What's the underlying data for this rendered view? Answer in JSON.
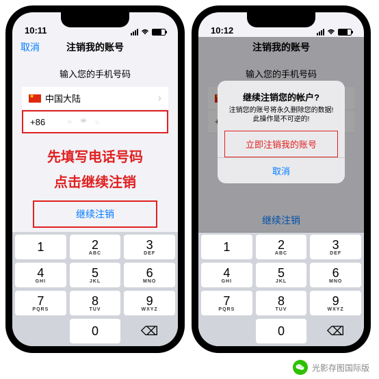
{
  "status": {
    "time_left": "10:11",
    "time_right": "10:12"
  },
  "nav": {
    "cancel": "取消",
    "title": "注销我的账号"
  },
  "prompt": "输入您的手机号码",
  "country": {
    "label": "中国大陆",
    "prefix": "+86"
  },
  "annotations": {
    "step1": "先填写电话号码",
    "step2": "点击继续注销"
  },
  "continue_label": "继续注销",
  "alert": {
    "title": "继续注销您的帐户?",
    "message_line1": "注销您的账号将永久删除您的数据!",
    "message_line2": "此操作是不可逆的!",
    "destructive": "立即注销我的账号",
    "cancel": "取消"
  },
  "keypad": {
    "keys": [
      {
        "num": "1",
        "letters": ""
      },
      {
        "num": "2",
        "letters": "ABC"
      },
      {
        "num": "3",
        "letters": "DEF"
      },
      {
        "num": "4",
        "letters": "GHI"
      },
      {
        "num": "5",
        "letters": "JKL"
      },
      {
        "num": "6",
        "letters": "MNO"
      },
      {
        "num": "7",
        "letters": "PQRS"
      },
      {
        "num": "8",
        "letters": "TUV"
      },
      {
        "num": "9",
        "letters": "WXYZ"
      },
      {
        "num": "",
        "letters": ""
      },
      {
        "num": "0",
        "letters": ""
      },
      {
        "num": "⌫",
        "letters": ""
      }
    ]
  },
  "footer": {
    "channel": "光影存图国际版"
  }
}
